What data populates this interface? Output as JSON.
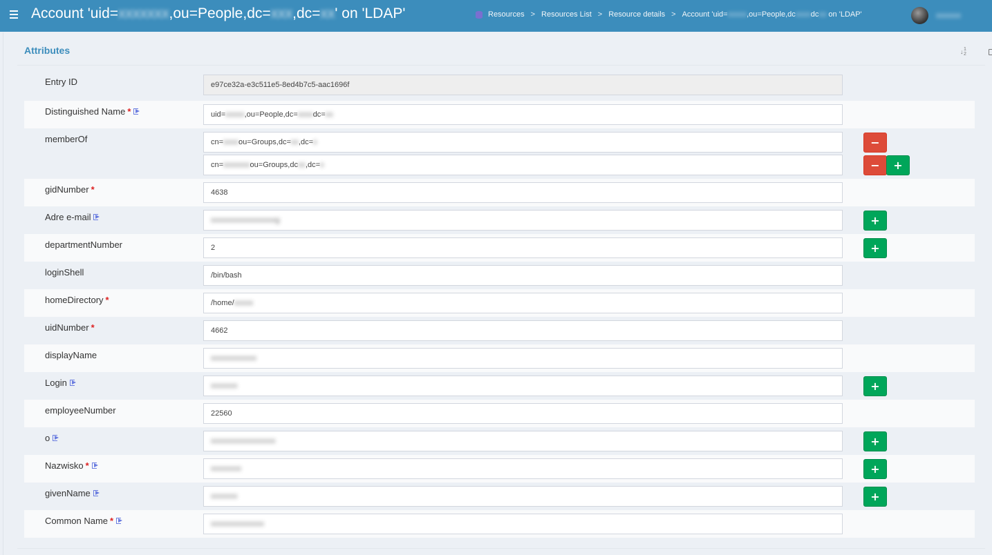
{
  "header": {
    "title_prefix": "Account 'uid=",
    "title_mask1": "xxxxxxx",
    "title_mid1": ",ou=People,dc=",
    "title_mask2": "xxx",
    "title_mid2": ",dc=",
    "title_mask3": "xx",
    "title_suffix": "' on 'LDAP'",
    "username": "xxxxxx",
    "colors": {
      "topbar": "#3c8dbc",
      "accent": "#3c8dbc"
    }
  },
  "breadcrumb": {
    "items": [
      "Resources",
      "Resources List",
      "Resource details"
    ],
    "current_prefix": "Account 'uid=",
    "current_mask1": "xxxxx",
    "current_mid1": ",ou=People,dc",
    "current_mask2": "xxxx",
    "current_mid2": "dc",
    "current_mask3": "xx",
    "current_suffix": " on 'LDAP'",
    "separator": ">"
  },
  "panel": {
    "title": "Attributes",
    "icons": [
      "sort-icon",
      "collapse-icon"
    ]
  },
  "attributes": [
    {
      "label": "Entry ID",
      "required": false,
      "link": false,
      "values": [
        "e97ce32a-e3c511e5-8ed4b7c5-aac1696f"
      ],
      "readonly": true
    },
    {
      "label": "Distinguished Name",
      "required": true,
      "link": true,
      "values": [
        {
          "pre": "uid=",
          "m1": "xxxxx",
          "mid": ",ou=People,dc=",
          "m2": "xxxx",
          "mid2": "dc=",
          "m3": "xx"
        }
      ]
    },
    {
      "label": "memberOf",
      "required": false,
      "link": false,
      "values": [
        {
          "pre": "cn=",
          "m1": "xxxx",
          "mid": "ou=Groups,dc=",
          "m2": "xx",
          "mid2": ",dc=",
          "m3": "x"
        },
        {
          "pre": "cn=",
          "m1": "xxxxxxx",
          "mid": "ou=Groups,dc",
          "m2": "xx",
          "mid2": ",dc=",
          "m3": "x"
        }
      ]
    },
    {
      "label": "gidNumber",
      "required": true,
      "link": false,
      "values": [
        "4638"
      ]
    },
    {
      "label": "Adre e-mail",
      "required": false,
      "link": true,
      "values": [
        {
          "mask": "xxxxxxxxxxxxxxxxxg"
        }
      ]
    },
    {
      "label": "departmentNumber",
      "required": false,
      "link": false,
      "values": [
        "2"
      ]
    },
    {
      "label": "loginShell",
      "required": false,
      "link": false,
      "values": [
        "/bin/bash"
      ]
    },
    {
      "label": "homeDirectory",
      "required": true,
      "link": false,
      "values": [
        {
          "pre": "/home/",
          "m1": "xxxxx"
        }
      ]
    },
    {
      "label": "uidNumber",
      "required": true,
      "link": false,
      "values": [
        "4662"
      ]
    },
    {
      "label": "displayName",
      "required": false,
      "link": false,
      "values": [
        {
          "mask": "xxxxxxxxxxxx"
        }
      ]
    },
    {
      "label": "Login",
      "required": false,
      "link": true,
      "values": [
        {
          "mask": "xxxxxxx"
        }
      ]
    },
    {
      "label": "employeeNumber",
      "required": false,
      "link": false,
      "values": [
        "22560"
      ]
    },
    {
      "label": "o",
      "required": false,
      "link": true,
      "values": [
        {
          "mask": "xxxxxxxxxxxxxxxxx"
        }
      ]
    },
    {
      "label": "Nazwisko",
      "required": true,
      "link": true,
      "values": [
        {
          "mask": "xxxxxxxx"
        }
      ]
    },
    {
      "label": "givenName",
      "required": false,
      "link": true,
      "values": [
        {
          "mask": "xxxxxxx"
        }
      ]
    },
    {
      "label": "Common Name",
      "required": true,
      "link": true,
      "values": [
        {
          "mask": "xxxxxxxxxxxxxx"
        }
      ]
    }
  ],
  "buttons": {
    "remove": "−",
    "add": "+"
  }
}
